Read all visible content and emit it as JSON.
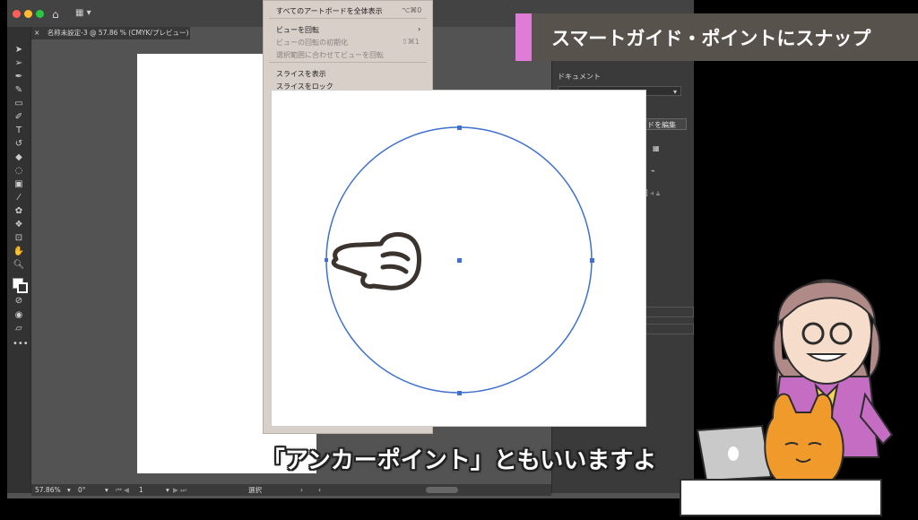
{
  "window": {
    "doc_tab": "名称未設定-3 @ 57.86 % (CMYK/プレビュー)",
    "close_glyph": "×"
  },
  "menu": {
    "items": [
      {
        "label": "すべてのアートボードを全体表示",
        "shortcut": "⌥⌘0",
        "enabled": true
      },
      {
        "label": "ビューを回転",
        "shortcut": "›",
        "enabled": true
      },
      {
        "label": "ビューの回転の初期化",
        "shortcut": "⇧⌘1",
        "enabled": false
      },
      {
        "label": "選択範囲に合わせてビューを回転",
        "shortcut": "",
        "enabled": false
      },
      {
        "label": "スライスを表示",
        "shortcut": "",
        "enabled": true
      },
      {
        "label": "スライスをロック",
        "shortcut": "",
        "enabled": true
      }
    ]
  },
  "right_panel": {
    "section": "ドキュメント",
    "edit_button": "ドを編集"
  },
  "status": {
    "zoom": "57.86%",
    "rotation": "0°",
    "artboard_num": "1",
    "tool": "選択"
  },
  "overlay": {
    "title": "スマートガイド・ポイントにスナップ",
    "caption": "「アンカーポイント」ともいいますよ"
  },
  "colors": {
    "accent_pink": "#e07bd8",
    "circle_blue": "#3e6fd1",
    "banner_bg": "#58524d",
    "bottom_strip": "#d9873f"
  }
}
